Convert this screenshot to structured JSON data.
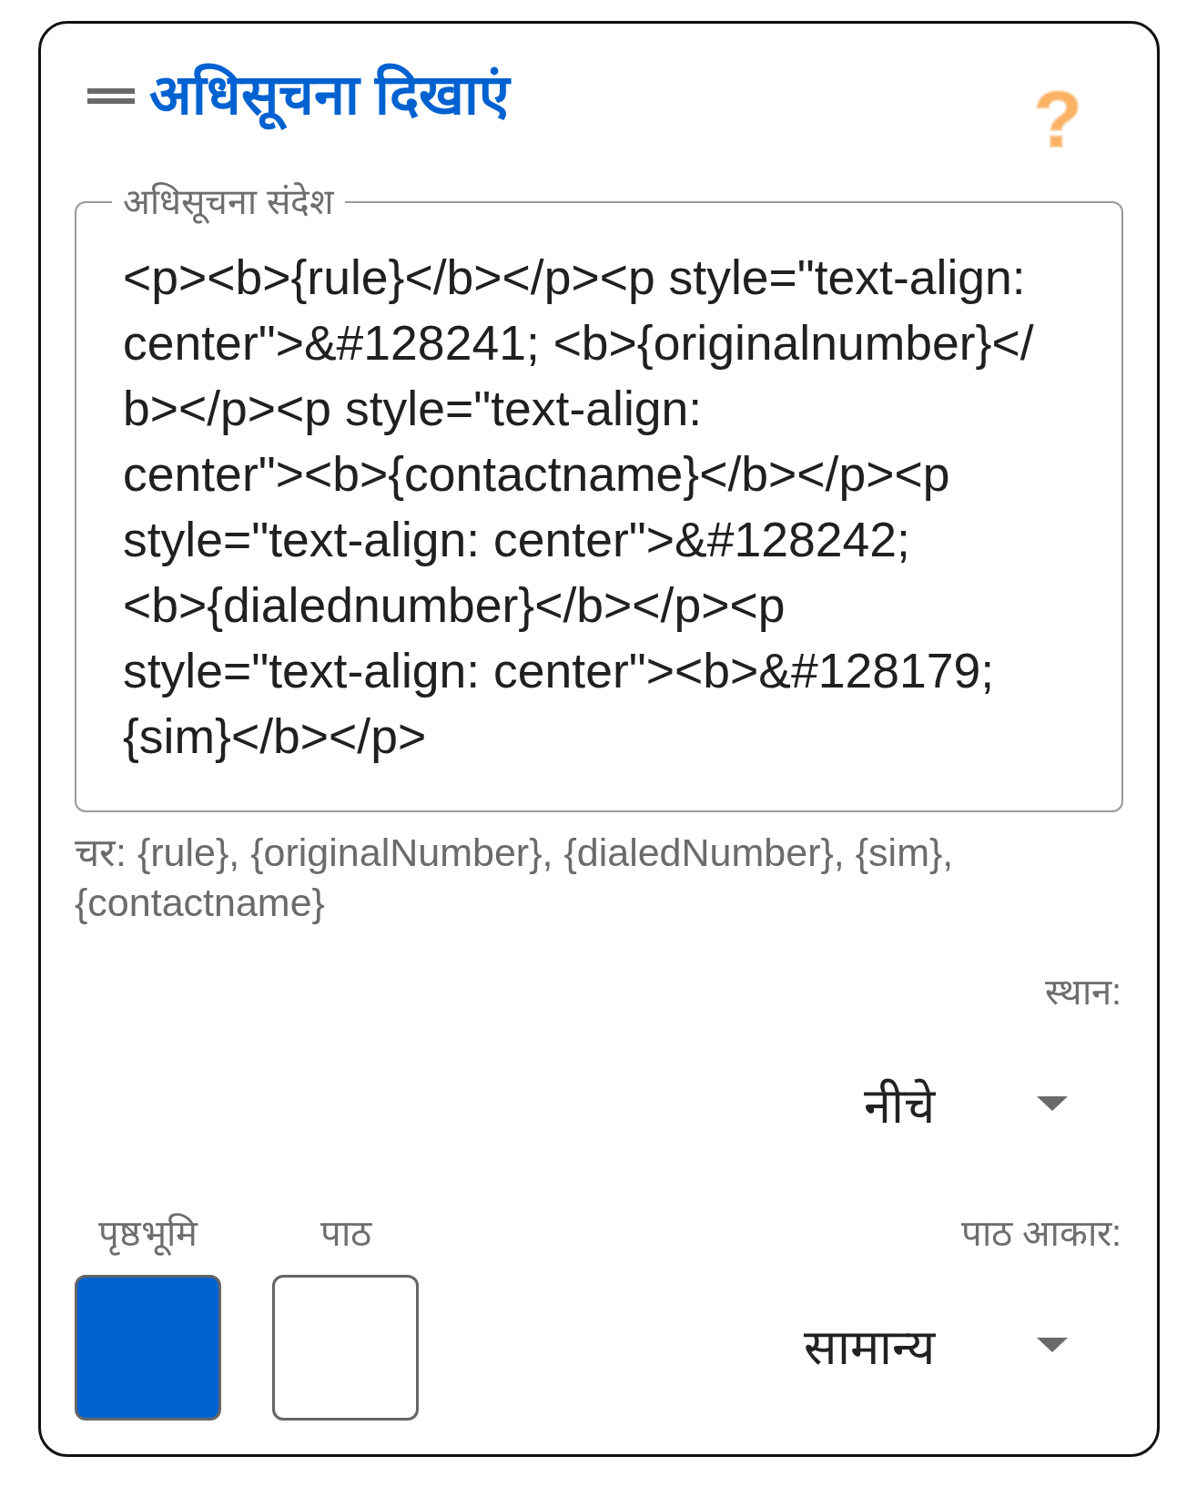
{
  "header": {
    "title": "अधिसूचना दिखाएं",
    "help": "?"
  },
  "message_field": {
    "label": "अधिसूचना संदेश",
    "value": "<p><b>{rule}</b></p><p style=\"text-align: center\">&#128241; <b>{originalnumber}</b></p><p style=\"text-align: center\"><b>{contactname}</b></p><p style=\"text-align: center\">&#128242; <b>{dialednumber}</b></p><p style=\"text-align: center\"><b>&#128179; {sim}</b></p>"
  },
  "helper_text": "चर: {rule}, {originalNumber}, {dialedNumber}, {sim}, {contactname}",
  "position": {
    "label": "स्थान:",
    "value": "नीचे"
  },
  "colors": [
    {
      "label": "पृष्ठभूमि",
      "color": "#0062d1"
    },
    {
      "label": "पाठ",
      "color": "#ffffff"
    }
  ],
  "text_size": {
    "label": "पाठ आकार:",
    "value": "सामान्य"
  }
}
